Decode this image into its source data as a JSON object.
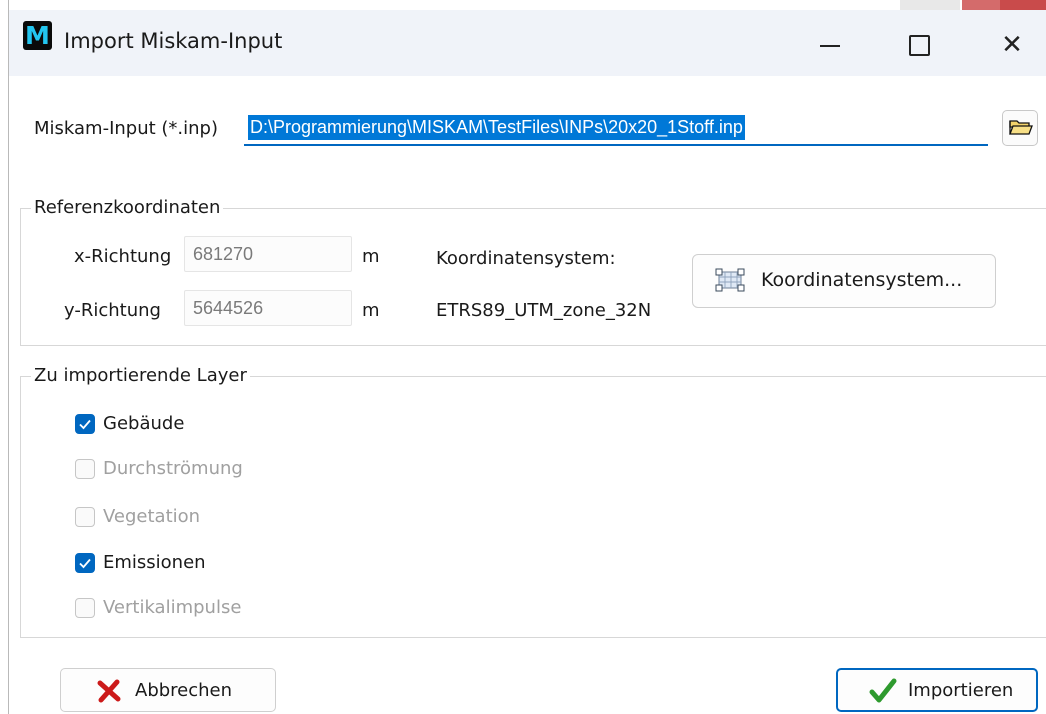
{
  "window": {
    "title": "Import Miskam-Input",
    "icon_letter": "M",
    "controls": {
      "minimize": "minimize-icon",
      "maximize": "maximize-icon",
      "close": "close-icon"
    }
  },
  "input_file": {
    "label": "Miskam-Input (*.inp)",
    "value": "D:\\Programmierung\\MISKAM\\TestFiles\\INPs\\20x20_1Stoff.inp",
    "browse_icon": "folder-open-icon"
  },
  "reference": {
    "group_title": "Referenzkoordinaten",
    "x_label": "x-Richtung",
    "x_value": "681270",
    "x_unit": "m",
    "y_label": "y-Richtung",
    "y_value": "5644526",
    "y_unit": "m",
    "cs_label": "Koordinatensystem:",
    "cs_value": "ETRS89_UTM_zone_32N",
    "cs_button": "Koordinatensystem..."
  },
  "layers": {
    "group_title": "Zu importierende Layer",
    "items": [
      {
        "label": "Gebäude",
        "checked": true,
        "enabled": true
      },
      {
        "label": "Durchströmung",
        "checked": false,
        "enabled": false
      },
      {
        "label": "Vegetation",
        "checked": false,
        "enabled": false
      },
      {
        "label": "Emissionen",
        "checked": true,
        "enabled": true
      },
      {
        "label": "Vertikalimpulse",
        "checked": false,
        "enabled": false
      }
    ]
  },
  "buttons": {
    "cancel": "Abbrechen",
    "import": "Importieren"
  },
  "colors": {
    "accent": "#0067c0",
    "selection": "#0078d7",
    "cancel_icon": "#cc1a1a",
    "import_icon": "#2e9a2e"
  }
}
